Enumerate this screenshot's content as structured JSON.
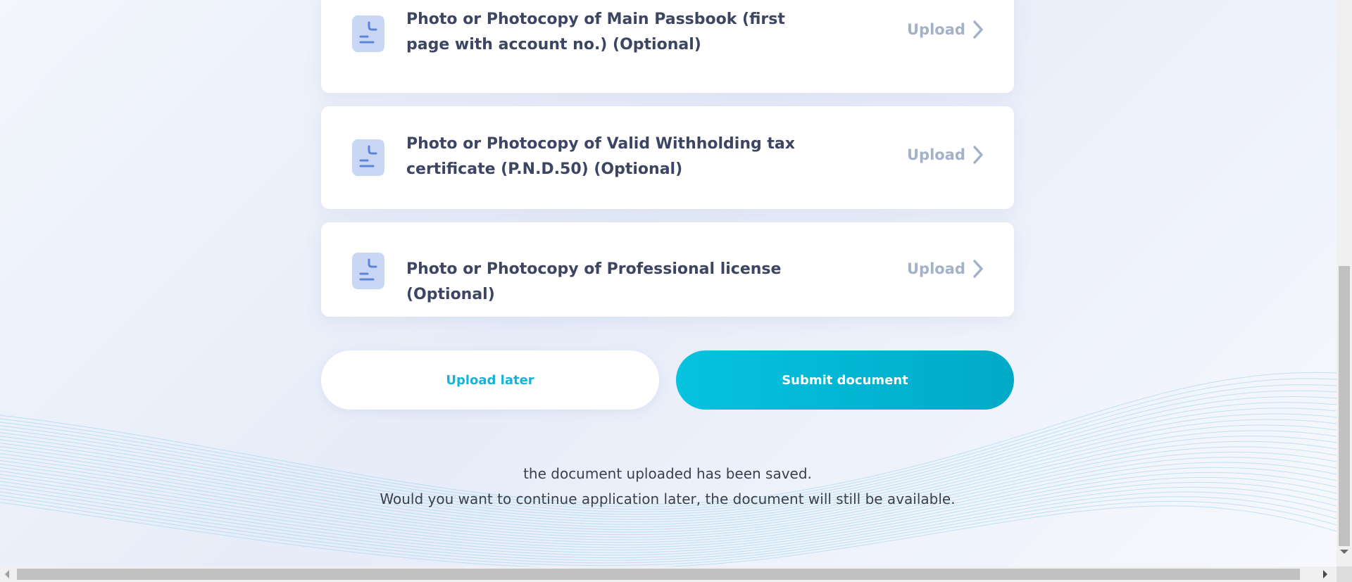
{
  "documents": [
    {
      "title": "Photo or Photocopy of Main Passbook (first page with account no.) (Optional)",
      "action": "Upload",
      "icon": "document-icon"
    },
    {
      "title": "Photo or Photocopy of Valid Withholding tax certificate (P.N.D.50) (Optional)",
      "action": "Upload",
      "icon": "document-icon"
    },
    {
      "title": "Photo or Photocopy of Professional license (Optional)",
      "action": "Upload",
      "icon": "document-icon"
    }
  ],
  "buttons": {
    "upload_later": "Upload later",
    "submit": "Submit document"
  },
  "notice": {
    "line1": "the document uploaded has been saved.",
    "line2": "Would you want to continue application later, the document will still be available."
  },
  "colors": {
    "accent": "#06c3df",
    "title_text": "#3c4663",
    "upload_text": "#a3b1c9",
    "icon_bg": "#c9d7f5",
    "icon_stroke": "#5b86d8"
  }
}
